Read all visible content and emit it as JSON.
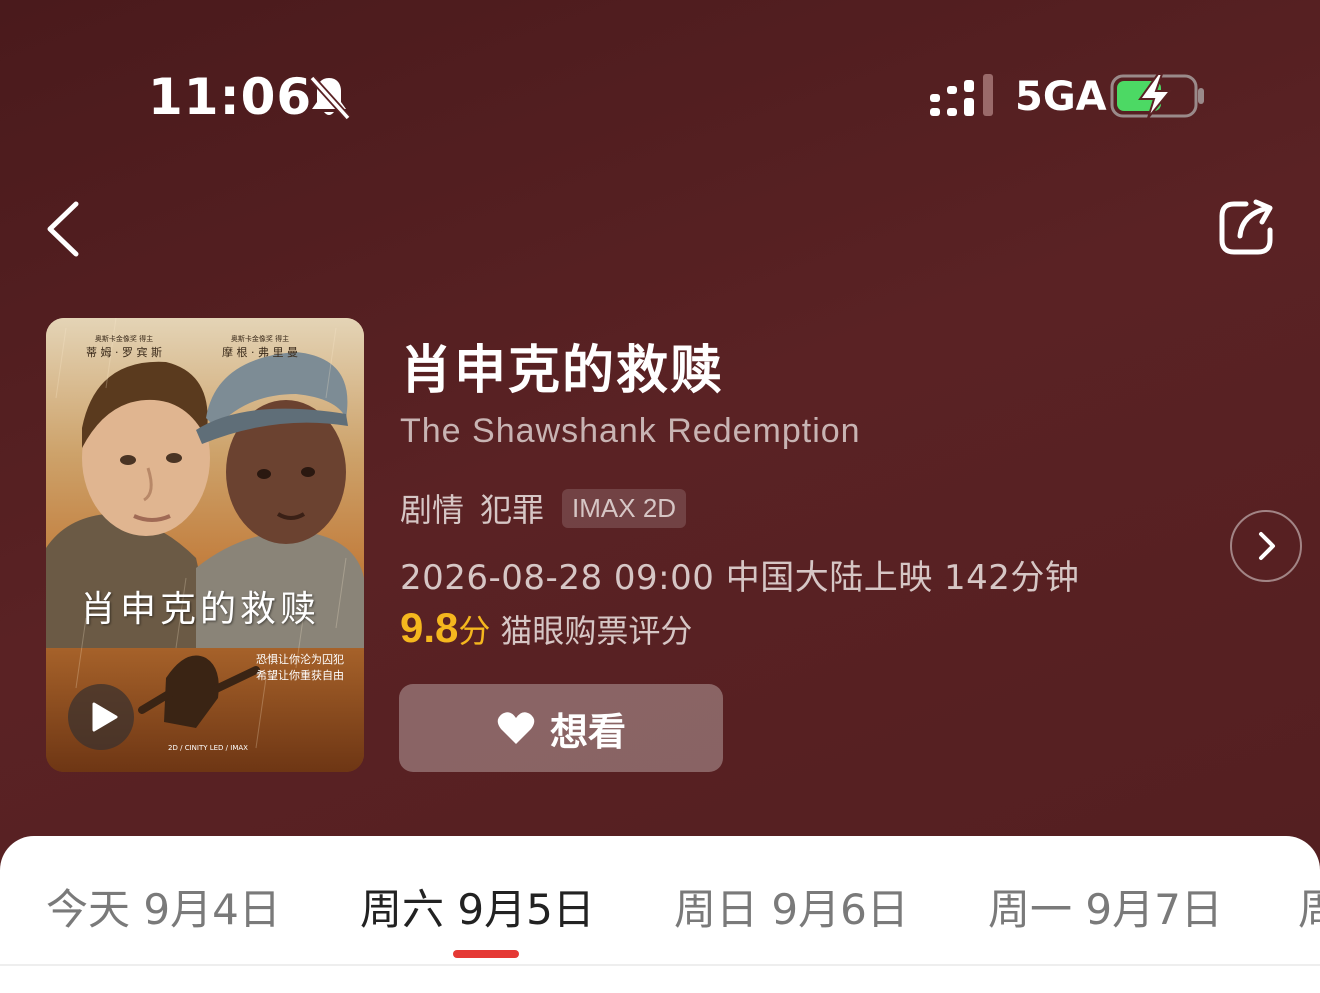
{
  "status_bar": {
    "time": "11:06",
    "network": "5GA",
    "icons": [
      "bell-muted-icon",
      "signal-icon",
      "battery-charging-icon"
    ],
    "battery_color": "#4cd964"
  },
  "nav": {
    "back_icon": "chevron-left-icon",
    "share_icon": "share-icon"
  },
  "poster": {
    "cast_left": "奥斯卡金像奖 得主\n蒂 姆 · 罗 宾 斯",
    "cast_left_award": "奥斯卡金像奖 得主",
    "cast_left_name": "蒂 姆 · 罗 宾 斯",
    "cast_right_award": "奥斯卡金像奖 得主",
    "cast_right_name": "摩 根 · 弗 里 曼",
    "title_cn": "肖申克的救赎",
    "tagline_1": "恐惧让你沦为囚犯",
    "tagline_2": "希望让你重获自由",
    "formats": "2D / CINITY LED / IMAX",
    "play_icon": "play-icon"
  },
  "movie": {
    "title": "肖申克的救赎",
    "english_title": "The Shawshank Redemption",
    "genres": [
      "剧情",
      "犯罪"
    ],
    "format_badge": "IMAX 2D",
    "release_info": "2026-08-28 09:00 中国大陆上映 142分钟",
    "score": "9.8",
    "score_unit": "分",
    "score_label": "猫眼购票评分",
    "score_color": "#f5b71e",
    "want_label": "想看",
    "want_icon": "heart-icon",
    "detail_icon": "chevron-right-icon"
  },
  "date_tabs": [
    {
      "label": "今天 9月4日",
      "active": false
    },
    {
      "label": "周六 9月5日",
      "active": true
    },
    {
      "label": "周日 9月6日",
      "active": false
    },
    {
      "label": "周一 9月7日",
      "active": false
    },
    {
      "label": "周",
      "active": false
    }
  ],
  "accent_color": "#e53935"
}
